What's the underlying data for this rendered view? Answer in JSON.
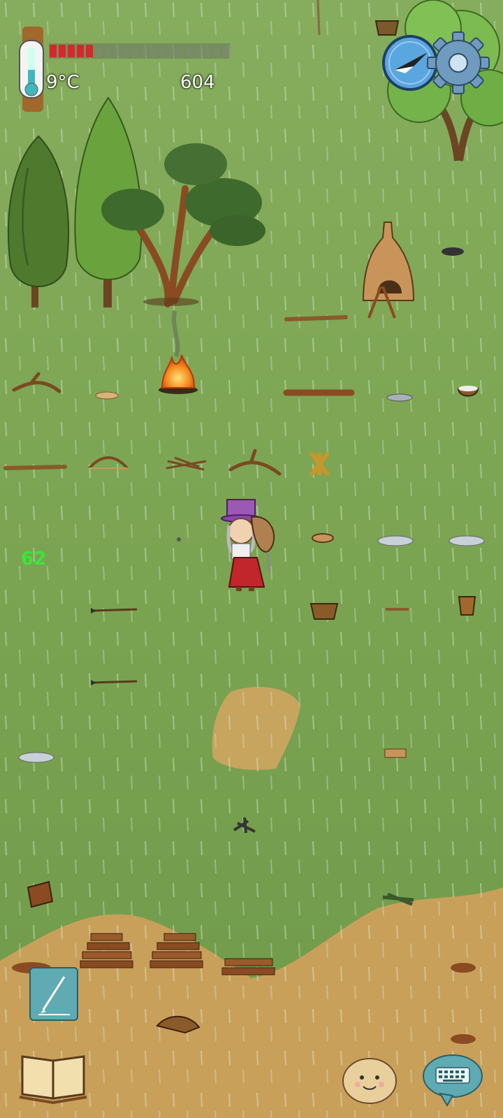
{
  "hud": {
    "temperature": "9°C",
    "score": "604",
    "food_segments_filled": 5,
    "food_segments_total": 20,
    "age_label": "62"
  },
  "icons": {
    "thermometer": "thermometer-icon",
    "compass": "compass-icon",
    "settings": "gear-icon",
    "note": "pencil-note-icon",
    "tech_book": "open-book-icon",
    "emote": "emote-face-icon",
    "chat": "keyboard-chat-icon"
  },
  "colors": {
    "grass": "#7fa556",
    "dirt": "#c9a05a",
    "food_red": "#d8262a",
    "age_green": "#39e639"
  }
}
